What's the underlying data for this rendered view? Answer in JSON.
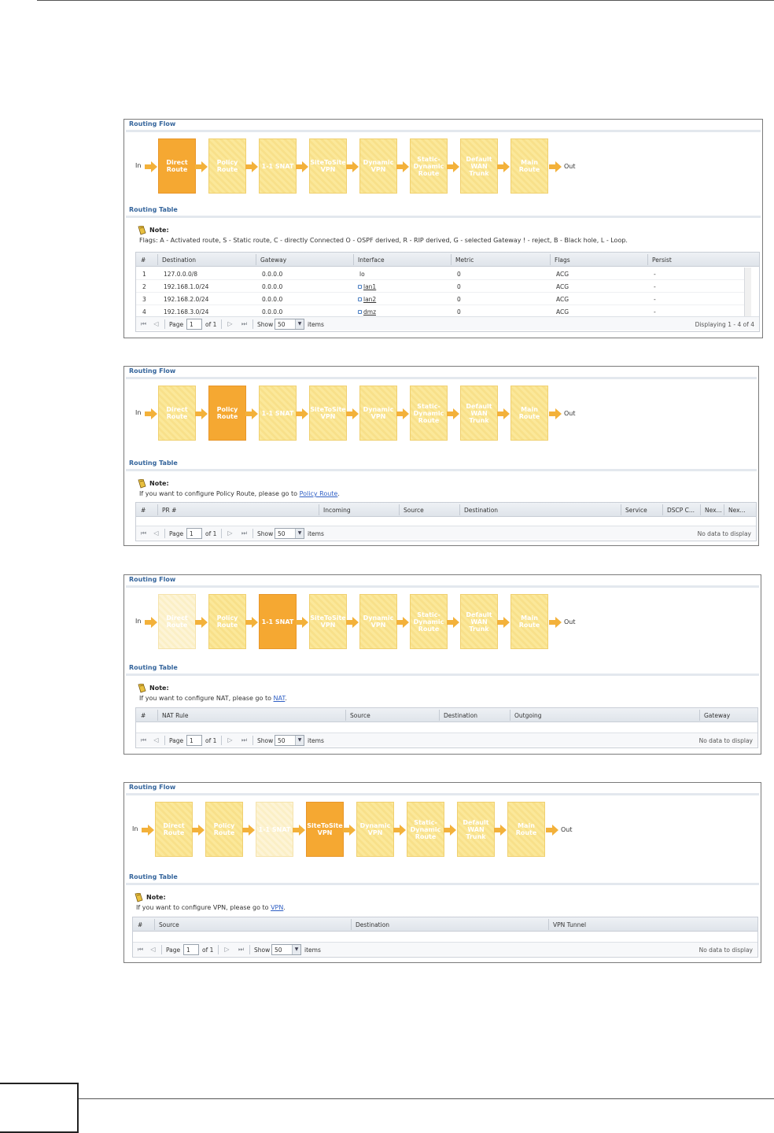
{
  "flow_labels": {
    "in": "In",
    "out": "Out"
  },
  "flow_steps": [
    "Direct Route",
    "Policy Route",
    "1-1 SNAT",
    "SiteToSite VPN",
    "Dynamic VPN",
    "Static-Dynamic Route",
    "Default WAN Trunk",
    "Main Route"
  ],
  "flow_lines": [
    [
      "Direct",
      "Route"
    ],
    [
      "Policy",
      "Route"
    ],
    [
      "1-1 SNAT"
    ],
    [
      "SiteToSite",
      "VPN"
    ],
    [
      "Dynamic",
      "VPN"
    ],
    [
      "Static-",
      "Dynamic",
      "Route"
    ],
    [
      "Default",
      "WAN",
      "Trunk"
    ],
    [
      "Main",
      "Route"
    ]
  ],
  "colors": {
    "active": "#f5a832",
    "inactive": "#fbe89a",
    "dim": "#fdf4d6",
    "title": "#35659c",
    "link": "#2f5fc4"
  },
  "panels": [
    {
      "routing_flow_title": "Routing Flow",
      "routing_table_title": "Routing Table",
      "active_step": 0,
      "dim_steps": [],
      "note_title": "Note:",
      "note_text": "Flags: A - Activated route, S - Static route, C - directly Connected O - OSPF derived, R - RIP derived, G - selected Gateway ! - reject, B - Black hole, L - Loop.",
      "note_link": "",
      "note_suffix": "",
      "columns": [
        "#",
        "Destination",
        "Gateway",
        "Interface",
        "Metric",
        "Flags",
        "Persist"
      ],
      "rows": [
        [
          "1",
          "127.0.0.0/8",
          "0.0.0.0",
          "lo",
          "0",
          "ACG",
          "-"
        ],
        [
          "2",
          "192.168.1.0/24",
          "0.0.0.0",
          "lan1",
          "0",
          "ACG",
          "-"
        ],
        [
          "3",
          "192.168.2.0/24",
          "0.0.0.0",
          "lan2",
          "0",
          "ACG",
          "-"
        ],
        [
          "4",
          "192.168.3.0/24",
          "0.0.0.0",
          "dmz",
          "0",
          "ACG",
          "-"
        ]
      ],
      "pager": {
        "page_label": "Page",
        "page_value": "1",
        "of_label": "of 1",
        "show_label": "Show",
        "show_value": "50",
        "items_label": "items",
        "status": "Displaying 1 - 4 of 4"
      }
    },
    {
      "routing_flow_title": "Routing Flow",
      "routing_table_title": "Routing Table",
      "active_step": 1,
      "dim_steps": [],
      "note_title": "Note:",
      "note_text": "If you want to configure Policy Route, please go to",
      "note_link": "Policy Route",
      "note_suffix": ".",
      "columns": [
        "#",
        "PR #",
        "Incoming",
        "Source",
        "Destination",
        "Service",
        "DSCP C...",
        "Nex...",
        "Nex..."
      ],
      "rows": [],
      "pager": {
        "page_label": "Page",
        "page_value": "1",
        "of_label": "of 1",
        "show_label": "Show",
        "show_value": "50",
        "items_label": "items",
        "status": "No data to display"
      }
    },
    {
      "routing_flow_title": "Routing Flow",
      "routing_table_title": "Routing Table",
      "active_step": 2,
      "dim_steps": [
        0
      ],
      "note_title": "Note:",
      "note_text": "If you want to configure NAT, please go to",
      "note_link": "NAT",
      "note_suffix": ".",
      "columns": [
        "#",
        "NAT Rule",
        "Source",
        "Destination",
        "Outgoing",
        "Gateway"
      ],
      "rows": [],
      "pager": {
        "page_label": "Page",
        "page_value": "1",
        "of_label": "of 1",
        "show_label": "Show",
        "show_value": "50",
        "items_label": "items",
        "status": "No data to display"
      }
    },
    {
      "routing_flow_title": "Routing Flow",
      "routing_table_title": "Routing Table",
      "active_step": 3,
      "dim_steps": [
        2
      ],
      "note_title": "Note:",
      "note_text": "If you want to configure VPN, please go to",
      "note_link": "VPN",
      "note_suffix": ".",
      "columns": [
        "#",
        "Source",
        "Destination",
        "VPN Tunnel"
      ],
      "rows": [],
      "pager": {
        "page_label": "Page",
        "page_value": "1",
        "of_label": "of 1",
        "show_label": "Show",
        "show_value": "50",
        "items_label": "items",
        "status": "No data to display"
      }
    }
  ]
}
